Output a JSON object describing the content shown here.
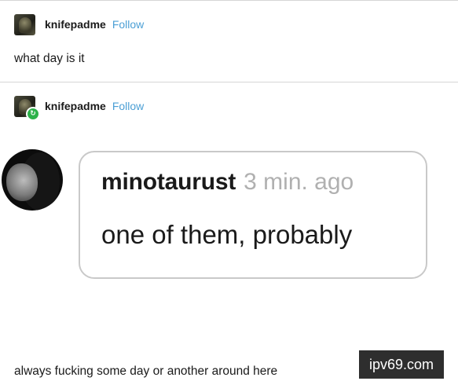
{
  "posts": [
    {
      "username": "knifepadme",
      "follow_label": "Follow",
      "text": "what day is it"
    },
    {
      "username": "knifepadme",
      "follow_label": "Follow",
      "reblog_badge": "↻"
    }
  ],
  "comment": {
    "username": "minotaurust",
    "time": "3 min. ago",
    "body": "one of them, probably"
  },
  "caption": "always fucking some day or another around here",
  "watermark": "ipv69.com",
  "colors": {
    "follow": "#4b9fd5",
    "reblog_badge": "#2db24a",
    "comment_border": "#c9c9c9",
    "timestamp": "#b0b0b0"
  },
  "icons": [
    "user-avatar-icon",
    "reblog-icon"
  ]
}
